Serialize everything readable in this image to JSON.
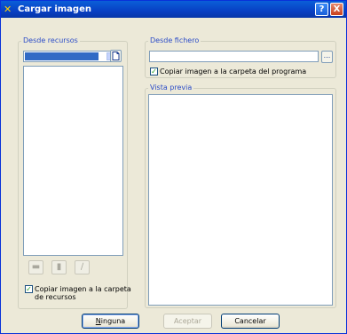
{
  "window": {
    "title": "Cargar imagen",
    "help_glyph": "?",
    "close_glyph": "X"
  },
  "resources": {
    "group_label": "Desde recursos",
    "combo_arrow": "⌄",
    "copy_checkbox_checked": true,
    "copy_checkbox_label_line1": "Copiar imagen a la carpeta",
    "copy_checkbox_label_line2": "de recursos"
  },
  "file": {
    "group_label": "Desde fichero",
    "path_value": "",
    "browse_label": "...",
    "copy_checkbox_checked": true,
    "copy_checkbox_label": "Copiar imagen a la carpeta del programa"
  },
  "preview": {
    "group_label": "Vista previa"
  },
  "buttons": {
    "none_first": "N",
    "none_rest": "inguna",
    "accept": "Aceptar",
    "cancel": "Cancelar"
  }
}
